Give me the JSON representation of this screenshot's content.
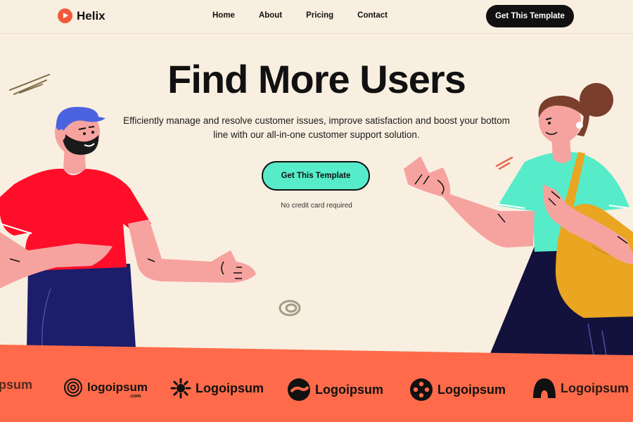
{
  "brand": {
    "name": "Helix",
    "icon": "play-icon",
    "color": "#f05a3a"
  },
  "nav": {
    "links": [
      "Home",
      "About",
      "Pricing",
      "Contact"
    ],
    "cta_label": "Get This Template"
  },
  "hero": {
    "title": "Find More Users",
    "subtitle": "Efficiently manage and resolve customer issues, improve satisfaction and boost your bottom line with our all-in-one customer support solution.",
    "cta_label": "Get This Template",
    "note": "No credit card required"
  },
  "logos": [
    {
      "text": "psum",
      "icon": "partial-logo"
    },
    {
      "text": "logoipsum",
      "sub": ".com",
      "icon": "concentric-circle-icon"
    },
    {
      "text": "Logoipsum",
      "icon": "sunburst-icon"
    },
    {
      "text": "Logoipsum",
      "icon": "split-circle-icon"
    },
    {
      "text": "Logoipsum",
      "icon": "diamond-dots-icon"
    },
    {
      "text": "Logoipsum",
      "icon": "arch-icon"
    }
  ],
  "colors": {
    "background": "#f9efe0",
    "accent": "#56ecc9",
    "logo_band": "#ff6b4a",
    "dark": "#111111"
  }
}
